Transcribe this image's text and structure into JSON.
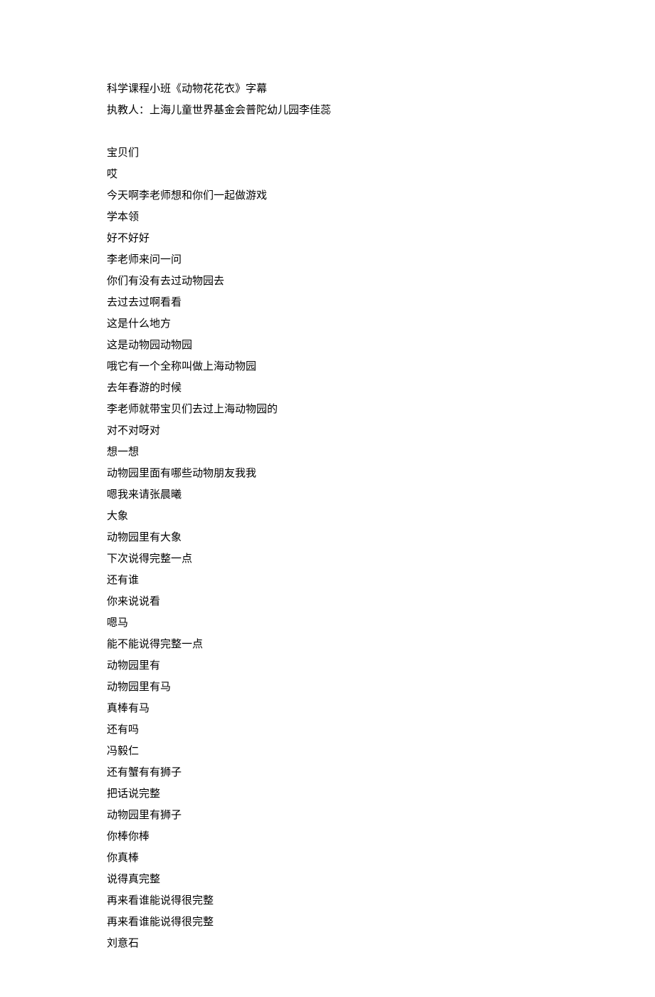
{
  "header": {
    "title": "科学课程小班《动物花花衣》字幕",
    "instructor": "执教人：上海儿童世界基金会普陀幼儿园李佳蕊"
  },
  "lines": [
    "宝贝们",
    "哎",
    "今天啊李老师想和你们一起做游戏",
    "学本领",
    "好不好好",
    "李老师来问一问",
    "你们有没有去过动物园去",
    "去过去过啊看看",
    "这是什么地方",
    "这是动物园动物园",
    "哦它有一个全称叫做上海动物园",
    "去年春游的时候",
    "李老师就带宝贝们去过上海动物园的",
    "对不对呀对",
    "想一想",
    "动物园里面有哪些动物朋友我我",
    "嗯我来请张晨曦",
    "大象",
    "动物园里有大象",
    "下次说得完整一点",
    "还有谁",
    "你来说说看",
    "嗯马",
    "能不能说得完整一点",
    "动物园里有",
    "动物园里有马",
    "真棒有马",
    "还有吗",
    "冯毅仁",
    "还有蟹有有狮子",
    "把话说完整",
    "动物园里有狮子",
    "你棒你棒",
    "你真棒",
    "说得真完整",
    "再来看谁能说得很完整",
    "再来看谁能说得很完整",
    "刘意石"
  ]
}
